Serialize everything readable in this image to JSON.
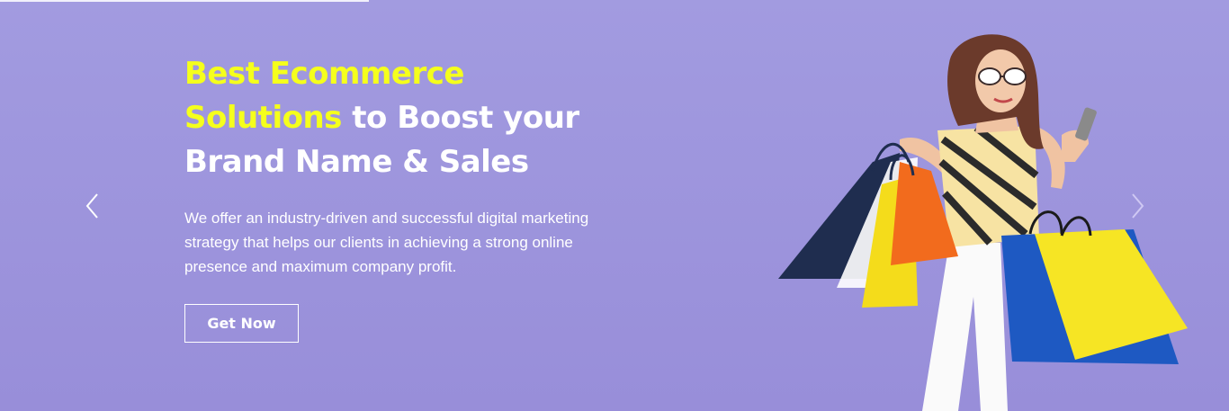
{
  "hero": {
    "headline_highlight_1": "Best Ecommerce",
    "headline_highlight_2": "Solutions",
    "headline_rest_1": " to Boost your",
    "headline_rest_2": "Brand Name & Sales",
    "description": "We offer an industry-driven and successful digital marketing strategy that helps our clients in achieving a strong online presence and maximum company profit.",
    "cta_label": "Get Now",
    "colors": {
      "background": "#9e97de",
      "highlight": "#f5ff1c",
      "text": "#ffffff"
    }
  },
  "carousel": {
    "prev_icon": "chevron-left-icon",
    "next_icon": "chevron-right-icon"
  },
  "image": {
    "subject": "woman-with-shopping-bags-image"
  }
}
